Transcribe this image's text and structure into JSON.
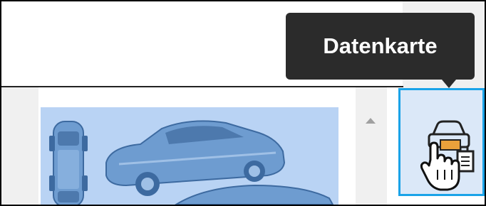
{
  "tooltip": {
    "text": "Datenkarte"
  },
  "toolbar": {
    "active_tool_icon": "vehicle-data-card-icon"
  },
  "thumbnail": {
    "subject": "car-overview-image"
  },
  "scrollbar": {
    "up_icon": "triangle-up-icon"
  },
  "cursor": {
    "icon": "hand-pointer-icon"
  },
  "colors": {
    "tooltip_bg": "#2b2b2b",
    "tool_button_bg": "#dbe8f8",
    "tool_button_border": "#1aa3e8",
    "thumbnail_bg": "#b9d3f4",
    "car_blue": "#5f8fc6"
  }
}
